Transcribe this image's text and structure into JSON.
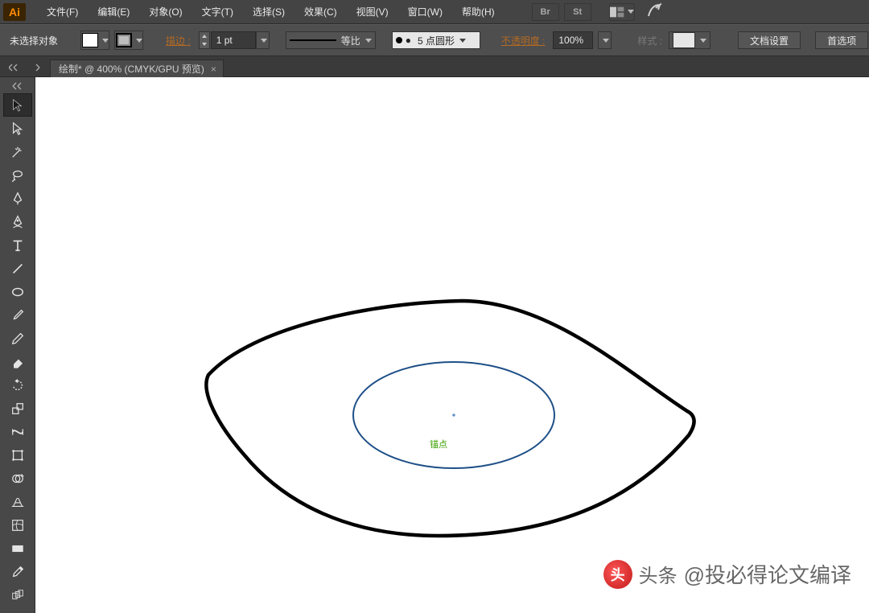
{
  "app": {
    "name_short": "Ai"
  },
  "menu": {
    "file": "文件(F)",
    "edit": "编辑(E)",
    "object": "对象(O)",
    "type": "文字(T)",
    "select": "选择(S)",
    "effect": "效果(C)",
    "view": "视图(V)",
    "window": "窗口(W)",
    "help": "帮助(H)"
  },
  "topicons": {
    "br": "Br",
    "st": "St"
  },
  "options": {
    "selection_status": "未选择对象",
    "stroke_label": "描边 :",
    "stroke_weight": "1 pt",
    "profile_label": "等比",
    "brush_name": "5 点圆形",
    "brush_bullet": "●",
    "opacity_label": "不透明度 :",
    "opacity_value": "100%",
    "style_label": "样式 :",
    "doc_setup": "文档设置",
    "preferences": "首选项"
  },
  "doc": {
    "tab_title": "绘制* @ 400% (CMYK/GPU 预览)",
    "close": "×"
  },
  "canvas": {
    "smartguide": "锚点"
  },
  "watermark": {
    "prefix": "头条",
    "text": "@投必得论文编译"
  },
  "colors": {
    "accent": "#ff8a00",
    "label_orange": "#b36a24",
    "selection_blue": "#1e4f87"
  }
}
